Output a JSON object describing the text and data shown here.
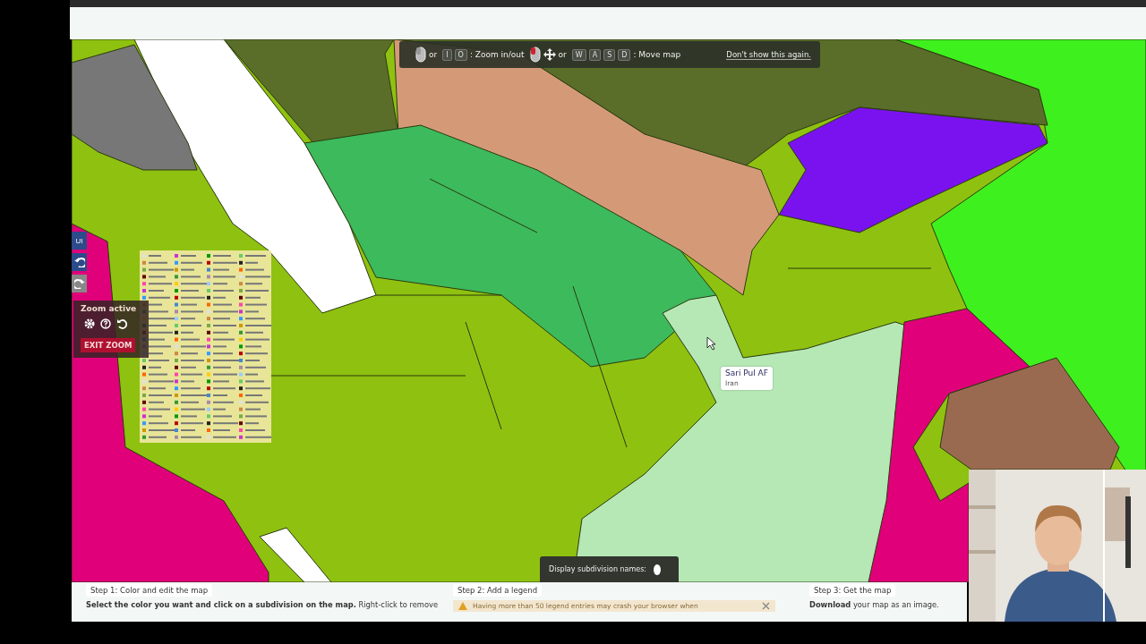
{
  "hint_bar": {
    "items": [
      {
        "kind": "mouse",
        "selected": false
      },
      {
        "kind": "text",
        "text": "or"
      },
      {
        "kind": "key",
        "text": "I"
      },
      {
        "kind": "key",
        "text": "O"
      },
      {
        "kind": "text",
        "text": ": Zoom in/out"
      },
      {
        "kind": "mouse",
        "selected": true
      },
      {
        "kind": "move"
      },
      {
        "kind": "text",
        "text": "or"
      },
      {
        "kind": "key",
        "text": "W"
      },
      {
        "kind": "key",
        "text": "A"
      },
      {
        "kind": "key",
        "text": "S"
      },
      {
        "kind": "key",
        "text": "D"
      },
      {
        "kind": "text",
        "text": ": Move map"
      }
    ],
    "dismiss": "Don't show this again."
  },
  "side_tools": [
    {
      "kind": "text",
      "label": "UI",
      "disabled": false
    },
    {
      "kind": "undo",
      "disabled": false
    },
    {
      "kind": "redo",
      "disabled": true
    }
  ],
  "zoom_panel": {
    "title": "Zoom active",
    "tools": [
      {
        "kind": "settings"
      },
      {
        "kind": "help"
      },
      {
        "kind": "reset"
      }
    ],
    "exit": "EXIT ZOOM"
  },
  "tooltip": {
    "name": "Sari Pul AF",
    "subtitle": "Iran"
  },
  "subdivision_toggle": {
    "label": "Display subdivision names:",
    "on": false
  },
  "steps": [
    {
      "kind": "edit",
      "title": "Step 1: Color and edit the map",
      "text": "**Select the color you want and click on a subdivision on the map.** Right-click to remove"
    },
    {
      "kind": "legend",
      "title": "Step 2: Add a legend",
      "warning": "Having more than 50 legend entries may crash your browser when"
    },
    {
      "kind": "download",
      "title": "Step 3: Get the map",
      "text": "**Download** your map as an image."
    }
  ]
}
